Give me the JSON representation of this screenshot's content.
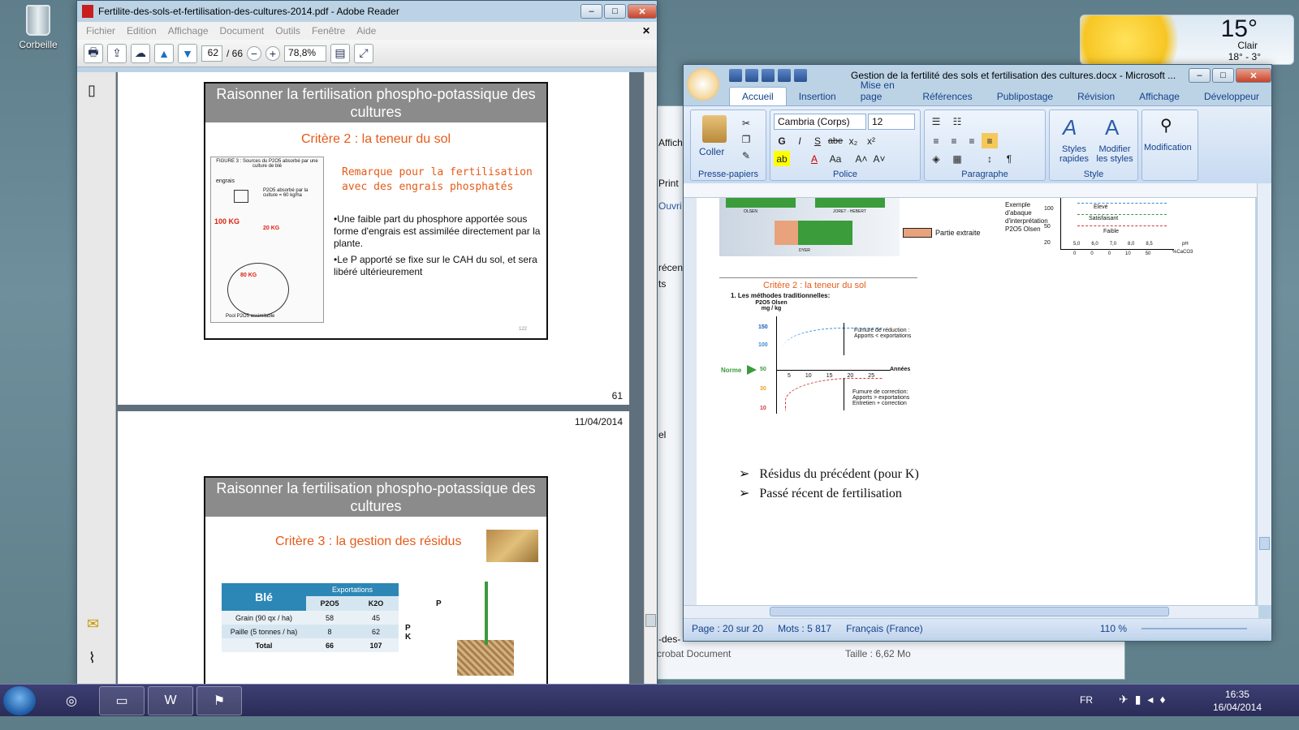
{
  "desktop": {
    "recycle_label": "Corbeille",
    "weather": {
      "temp": "15°",
      "condition": "Clair",
      "range": "18° - 3°"
    }
  },
  "reader": {
    "title": "Fertilite-des-sols-et-fertilisation-des-cultures-2014.pdf - Adobe Reader",
    "menu": [
      "Fichier",
      "Edition",
      "Affichage",
      "Document",
      "Outils",
      "Fenêtre",
      "Aide"
    ],
    "page_current": "62",
    "page_total": "/ 66",
    "zoom": "78,8%",
    "page61": {
      "slide_title": "Raisonner la fertilisation phospho-potassique des cultures",
      "critere": "Critère 2 : la teneur du sol",
      "remarque_line1": "Remarque pour la fertilisation",
      "remarque_line2": "avec des engrais phosphatés",
      "bullet1": "•Une faible part du phosphore apportée sous forme d'engrais est assimilée directement par la plante.",
      "bullet2": "•Le P apporté se fixe sur le CAH du sol, et sera libéré ultérieurement",
      "fig_caption": "FIGURE 3 : Sources du P2O5 absorbé par une culture de blé",
      "fig_engrais": "engrais",
      "fig_absorbe": "P2O5 absorbé par la culture = 60 kg/ha",
      "fig_100kg": "100 KG",
      "fig_20kg": "20 KG",
      "fig_80kg": "80 KG",
      "fig_pool": "Pool P2O5 assimilable",
      "slide_num": "122",
      "page_number": "61"
    },
    "page62": {
      "date": "11/04/2014",
      "slide_title": "Raisonner la fertilisation phospho-potassique des cultures",
      "critere": "Critère 3 : la gestion des résidus",
      "table": {
        "crop": "Blé",
        "exports_header": "Exportations",
        "col1": "P2O5",
        "col2": "K2O",
        "rows": [
          [
            "Grain (90 qx / ha)",
            "58",
            "45"
          ],
          [
            "Paille (5 tonnes / ha)",
            "8",
            "62"
          ],
          [
            "Total",
            "66",
            "107"
          ]
        ]
      },
      "label_p": "P",
      "label_pk": "P K"
    }
  },
  "bg_window": {
    "items": [
      "Affich",
      "Print",
      "Ouvri",
      "récen",
      "ts",
      "el"
    ],
    "bottom_left": "crobat Document",
    "bottom_mid": "Taille : 6,62 Mo",
    "bottom_name": "-des-"
  },
  "word": {
    "title": "Gestion de la fertilité des sols et fertilisation des cultures.docx - Microsoft ...",
    "tabs": [
      "Accueil",
      "Insertion",
      "Mise en page",
      "Références",
      "Publipostage",
      "Révision",
      "Affichage",
      "Développeur"
    ],
    "font": "Cambria (Corps)",
    "size": "12",
    "groups": {
      "clipboard": "Presse-papiers",
      "police": "Police",
      "paragraphe": "Paragraphe",
      "style": "Style",
      "edit": ""
    },
    "coller": "Coller",
    "styles_rapides": "Styles rapides",
    "modifier_styles": "Modifier les styles",
    "modification": "Modification",
    "doc": {
      "partie_extraite": "Partie extraite",
      "olsen": "OLSEN",
      "joret": "JORET - HEBERT",
      "dyer": "DYER",
      "abaque_title": "Exemple d'abaque d'interprétation P2O5 Olsen",
      "abaque_levels": [
        "Elevé",
        "Satisfaisant",
        "Faible"
      ],
      "abaque_y": [
        "100",
        "50",
        "20"
      ],
      "abaque_x": [
        "5,0",
        "6,0",
        "7,0",
        "8,0",
        "8,5"
      ],
      "abaque_x2": [
        "0",
        "0",
        "0",
        "10",
        "50"
      ],
      "abaque_ph": "pH",
      "abaque_caco3": "%CaCO3",
      "critere2": "Critère 2 : la teneur du sol",
      "methodes": "1. Les méthodes traditionnelles:",
      "chart_ylabel": "P2O5 Olsen mg / kg",
      "chart_y": [
        "150",
        "100",
        "50",
        "30",
        "10"
      ],
      "chart_x": [
        "5",
        "10",
        "15",
        "20",
        "25"
      ],
      "chart_xlabel": "Années",
      "norme": "Norme",
      "fumure_red": "Fumure de réduction : Apports < exportations",
      "fumure_corr": "Fumure de correction: Apports > exportations Entretien + correction",
      "bullet1": "Résidus du précédent (pour K)",
      "bullet2": "Passé récent de fertilisation"
    },
    "status": {
      "page": "Page : 20 sur 20",
      "mots": "Mots : 5 817",
      "lang": "Français (France)",
      "zoom": "110 %"
    }
  },
  "taskbar": {
    "lang": "FR",
    "time": "16:35",
    "date": "16/04/2014"
  }
}
